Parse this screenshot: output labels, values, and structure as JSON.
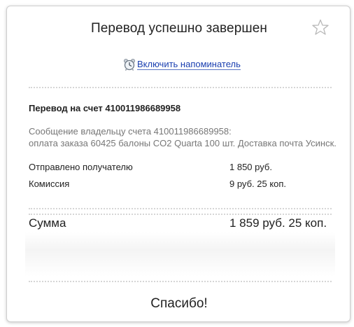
{
  "header": {
    "title": "Перевод успешно завершен",
    "favorite_icon": "star-outline-icon"
  },
  "reminder": {
    "icon": "alarm-clock-icon",
    "label": "Включить напоминатель"
  },
  "transfer": {
    "heading": "Перевод на счет 410011986689958",
    "message_line1": "Сообщение владельцу счета 410011986689958:",
    "message_line2": "оплата заказа 60425 балоны CO2 Quarta 100 шт. Доставка почта Усинск.",
    "rows": [
      {
        "label": "Отправлено получателю",
        "value": "1 850 руб."
      },
      {
        "label": "Комиссия",
        "value": "9 руб. 25 коп."
      }
    ],
    "total": {
      "label": "Сумма",
      "value": "1 859 руб. 25 коп."
    }
  },
  "footer": {
    "thanks": "Спасибо!"
  },
  "colors": {
    "link": "#1a3fb0",
    "muted_text": "#777777",
    "text": "#222222",
    "separator": "#d6d6d6"
  }
}
